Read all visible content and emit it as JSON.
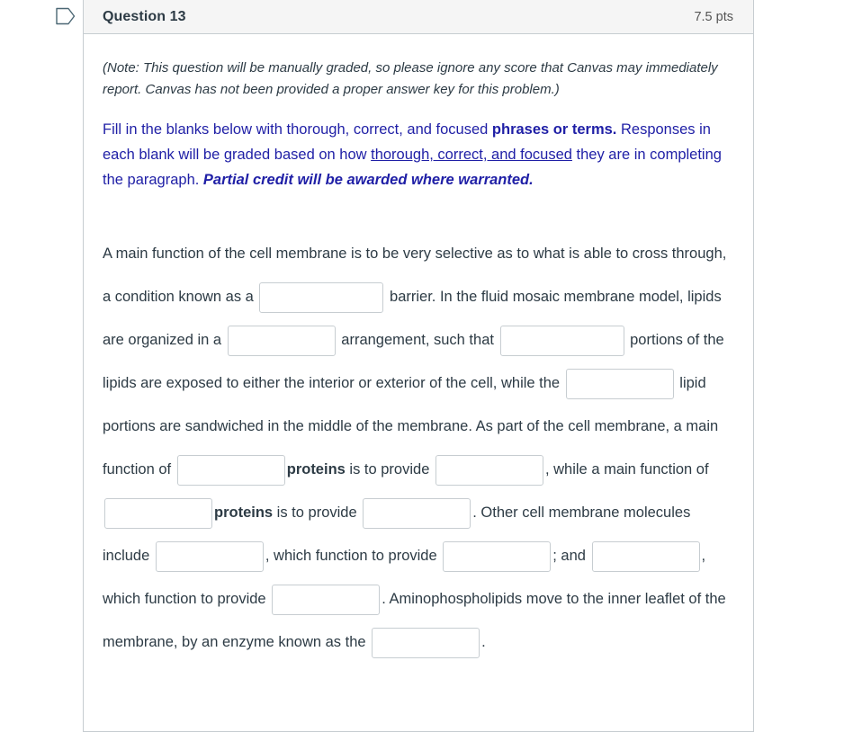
{
  "icons": {
    "flag": "flag-outline-icon"
  },
  "colors": {
    "header_bg": "#f5f5f5",
    "border": "#c7cdd1",
    "body_text": "#2d3b45",
    "instruction_text": "#1f1fa6",
    "points_text": "#555555"
  },
  "question": {
    "name": "Question 13",
    "points": "7.5 pts",
    "note": "(Note: This question will be manually graded, so please ignore any score that Canvas may immediately report.  Canvas has not been provided a proper answer key for this problem.)",
    "instructions": {
      "part1": "Fill in the blanks below with thorough, correct, and focused ",
      "bold1": "phrases or terms.",
      "part2": " Responses in each blank will be graded based on how ",
      "underline1": "thorough, correct, and focused",
      "part3": " they are in completing the paragraph. ",
      "italic1": "Partial credit will be awarded where warranted."
    },
    "paragraph": {
      "t1": "A main function of the cell membrane is to be very selective as to what is able to cross through, a condition known as a ",
      "t2": " barrier.  In the fluid mosaic membrane model, lipids are organized in a ",
      "t3": " arrangement, such that ",
      "t4": " portions of the lipids are exposed to either the interior or exterior of the cell, while the ",
      "t5": " lipid portions are sandwiched in the middle of the membrane.  As part of the cell membrane, a main function of ",
      "t6_bold": "proteins",
      "t7": " is to provide ",
      "t8": ", while a main function of ",
      "t9_bold": "proteins",
      "t10": " is to provide ",
      "t11": ".  Other cell membrane molecules include ",
      "t12": ", which function to provide ",
      "t13": "; and ",
      "t14": ", which function to provide ",
      "t15": ".  Aminophospholipids move to the inner leaflet of the membrane, by an enzyme known as the ",
      "t16": "."
    },
    "blanks": [
      {
        "id": "blank-1",
        "value": "",
        "placeholder": ""
      },
      {
        "id": "blank-2",
        "value": "",
        "placeholder": ""
      },
      {
        "id": "blank-3",
        "value": "",
        "placeholder": ""
      },
      {
        "id": "blank-4",
        "value": "",
        "placeholder": ""
      },
      {
        "id": "blank-5",
        "value": "",
        "placeholder": ""
      },
      {
        "id": "blank-6",
        "value": "",
        "placeholder": ""
      },
      {
        "id": "blank-7",
        "value": "",
        "placeholder": ""
      },
      {
        "id": "blank-8",
        "value": "",
        "placeholder": ""
      },
      {
        "id": "blank-9",
        "value": "",
        "placeholder": ""
      },
      {
        "id": "blank-10",
        "value": "",
        "placeholder": ""
      },
      {
        "id": "blank-11",
        "value": "",
        "placeholder": ""
      },
      {
        "id": "blank-12",
        "value": "",
        "placeholder": ""
      },
      {
        "id": "blank-13",
        "value": "",
        "placeholder": ""
      },
      {
        "id": "blank-14",
        "value": "",
        "placeholder": ""
      }
    ]
  }
}
